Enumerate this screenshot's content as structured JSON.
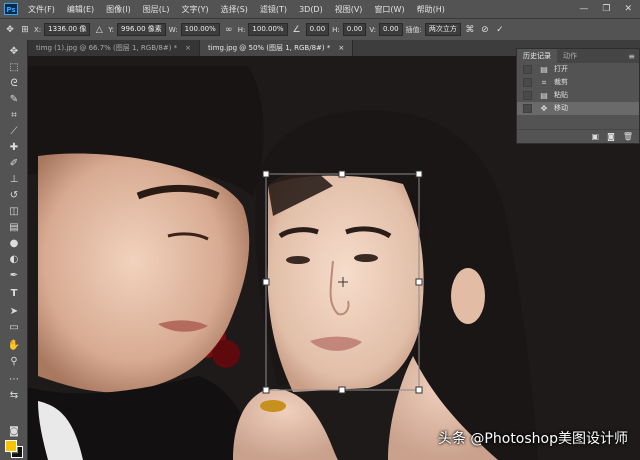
{
  "menu": {
    "logo": "Ps",
    "items": [
      "文件(F)",
      "编辑(E)",
      "图像(I)",
      "图层(L)",
      "文字(Y)",
      "选择(S)",
      "滤镜(T)",
      "3D(D)",
      "视图(V)",
      "窗口(W)",
      "帮助(H)"
    ],
    "window_controls": [
      "—",
      "❐",
      "✕"
    ]
  },
  "options": {
    "x_label": "X:",
    "x_value": "1336.00 像",
    "y_label": "Y:",
    "y_value": "996.00 像素",
    "w_label": "W:",
    "w_value": "100.00%",
    "h_label": "H:",
    "h_value": "100.00%",
    "angle_value": "0.00",
    "hskew_label": "H:",
    "hskew_value": "0.00",
    "vskew_label": "V:",
    "vskew_value": "0.00",
    "interp_label": "插值:",
    "interp_value": "两次立方"
  },
  "tabs": [
    {
      "label": "timg (1).jpg @ 66.7% (图层 1, RGB/8#) *",
      "close": "×"
    },
    {
      "label": "timg.jpg @ 50% (图层 1, RGB/8#) *",
      "close": "×"
    }
  ],
  "history": {
    "tab_history": "历史记录",
    "tab_actions": "动作",
    "menu_icon": "≡",
    "items": [
      {
        "label": "打开",
        "icon": "document-icon"
      },
      {
        "label": "裁剪",
        "icon": "crop-icon"
      },
      {
        "label": "粘贴",
        "icon": "document-icon"
      },
      {
        "label": "移动",
        "icon": "move-icon"
      }
    ]
  },
  "watermark": "头条 @Photoshop美图设计师",
  "colors": {
    "foreground": "#f6c400",
    "background": "#111111",
    "ui_dark": "#535353"
  }
}
